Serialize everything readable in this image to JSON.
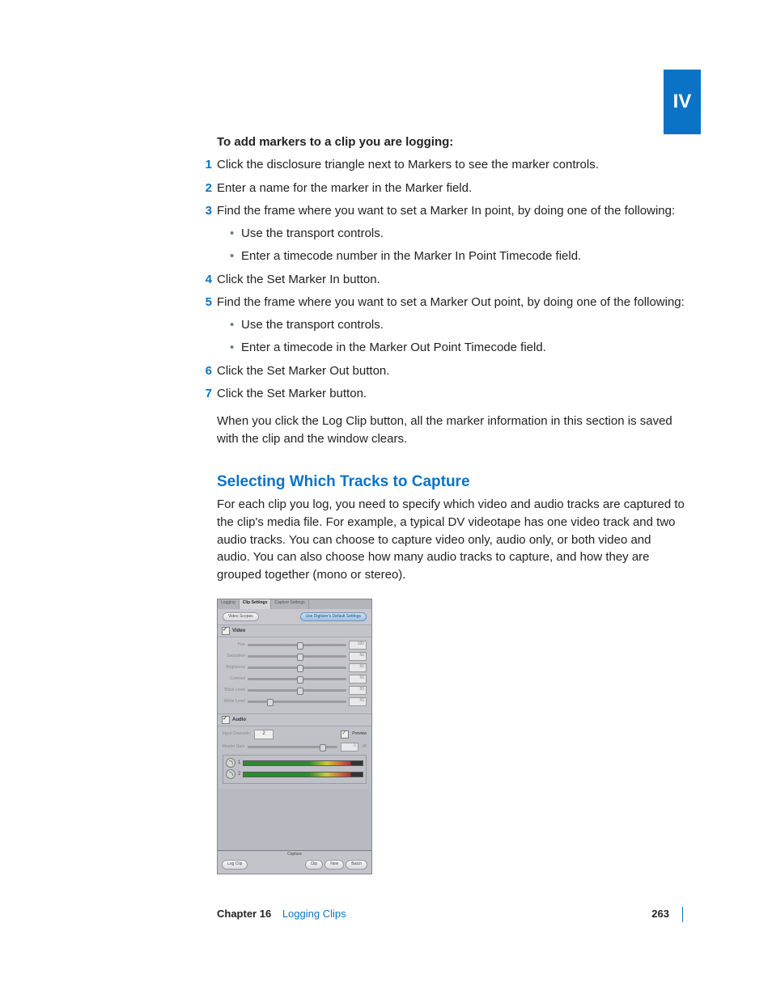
{
  "part_tab": "IV",
  "intro_heading": "To add markers to a clip you are logging:",
  "steps": [
    {
      "n": "1",
      "text": "Click the disclosure triangle next to Markers to see the marker controls."
    },
    {
      "n": "2",
      "text": "Enter a name for the marker in the Marker field."
    },
    {
      "n": "3",
      "text": "Find the frame where you want to set a Marker In point, by doing one of the following:",
      "bullets": [
        "Use the transport controls.",
        "Enter a timecode number in the Marker In Point Timecode field."
      ]
    },
    {
      "n": "4",
      "text": "Click the Set Marker In button."
    },
    {
      "n": "5",
      "text": "Find the frame where you want to set a Marker Out point, by doing one of the following:",
      "bullets": [
        "Use the transport controls.",
        "Enter a timecode in the Marker Out Point Timecode field."
      ]
    },
    {
      "n": "6",
      "text": "Click the Set Marker Out button."
    },
    {
      "n": "7",
      "text": "Click the Set Marker button."
    }
  ],
  "after_steps": "When you click the Log Clip button, all the marker information in this section is saved with the clip and the window clears.",
  "section_heading": "Selecting Which Tracks to Capture",
  "section_body": "For each clip you log, you need to specify which video and audio tracks are captured to the clip's media file. For example, a typical DV videotape has one video track and two audio tracks. You can choose to capture video only, audio only, or both video and audio. You can also choose how many audio tracks to capture, and how they are grouped together (mono or stereo).",
  "panel": {
    "tabs": {
      "logging": "Logging",
      "clip_settings": "Clip Settings",
      "capture_settings": "Capture Settings"
    },
    "video_scopes_btn": "Video Scopes",
    "digitizer_btn": "Use Digitizer's Default Settings",
    "video_label": "Video",
    "sliders": [
      {
        "label": "Hue",
        "value": "180",
        "pos": 50
      },
      {
        "label": "Saturation",
        "value": "50",
        "pos": 50
      },
      {
        "label": "Brightness",
        "value": "50",
        "pos": 50
      },
      {
        "label": "Contrast",
        "value": "50",
        "pos": 50
      },
      {
        "label": "Black Level",
        "value": "50",
        "pos": 50
      },
      {
        "label": "White Level",
        "value": "50",
        "pos": 20
      }
    ],
    "audio_label": "Audio",
    "input_channels_label": "Input Channels:",
    "input_channels_value": "2",
    "preview_label": "Preview",
    "master_gain_label": "Master Gain",
    "master_gain_value": "0",
    "master_gain_unit": "dB",
    "meters": [
      "1",
      "2"
    ],
    "capture_label": "Capture",
    "log_clip_btn": "Log Clip",
    "clip_btn": "Clip",
    "now_btn": "Now",
    "batch_btn": "Batch"
  },
  "footer": {
    "chapter_label": "Chapter 16",
    "chapter_title": "Logging Clips",
    "page": "263"
  }
}
